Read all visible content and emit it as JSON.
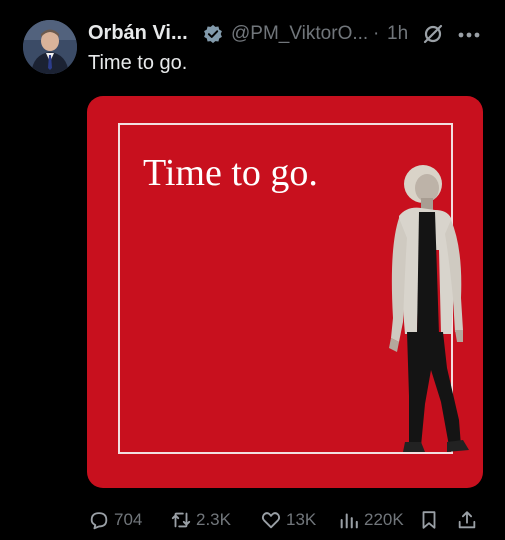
{
  "tweet": {
    "author_name": "Orbán Vi...",
    "handle": "@PM_ViktorO...",
    "separator": "·",
    "time": "1h",
    "text": "Time to go.",
    "media_text": "Time to go."
  },
  "actions": {
    "replies": "704",
    "reposts": "2.3K",
    "likes": "13K",
    "views": "220K"
  },
  "colors": {
    "background": "#000000",
    "media_red": "#c8101e",
    "verified": "#829aab",
    "muted": "#71767b"
  }
}
